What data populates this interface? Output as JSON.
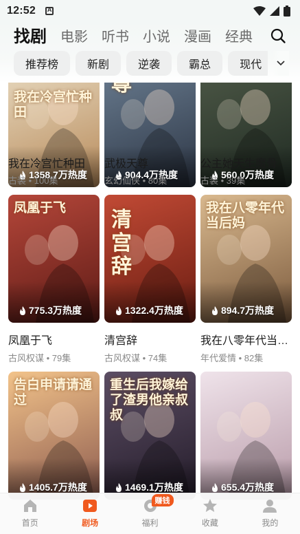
{
  "status_bar": {
    "time": "12:52"
  },
  "top_tabs": [
    {
      "label": "找剧",
      "active": true
    },
    {
      "label": "电影",
      "active": false
    },
    {
      "label": "听书",
      "active": false
    },
    {
      "label": "小说",
      "active": false
    },
    {
      "label": "漫画",
      "active": false
    },
    {
      "label": "经典",
      "active": false
    }
  ],
  "chips": [
    "推荐榜",
    "新剧",
    "逆袭",
    "霸总",
    "现代"
  ],
  "cards": [
    {
      "title": "我在冷宫忙种田",
      "sub": "古装 • 100集",
      "heat": "1358.7万热度",
      "poster_text": "我在冷宫忙种田",
      "colors": [
        "#e9dcc3",
        "#b78a5a"
      ]
    },
    {
      "title": "武极天尊",
      "sub": "玄幻仙侠 • 80集",
      "heat": "904.4万热度",
      "poster_text": "尊",
      "colors": [
        "#6c7f93",
        "#2c3544"
      ]
    },
    {
      "title": "公主她天生魔骨",
      "sub": "古装 • 39集",
      "heat": "560.0万热度",
      "poster_text": "",
      "colors": [
        "#4f5a48",
        "#1f2a22"
      ]
    },
    {
      "title": "凤凰于飞",
      "sub": "古风权谋 • 79集",
      "heat": "775.3万热度",
      "poster_text": "凤凰于飞",
      "colors": [
        "#b5473a",
        "#5e1b16"
      ]
    },
    {
      "title": "清宫辞",
      "sub": "古风权谋 • 74集",
      "heat": "1322.4万热度",
      "poster_text": "清宫辞",
      "colors": [
        "#c14a35",
        "#6b1d12"
      ]
    },
    {
      "title": "我在八零年代当…",
      "sub": "年代爱情 • 82集",
      "heat": "894.7万热度",
      "poster_text": "我在八零年代当后妈",
      "colors": [
        "#d9b98f",
        "#7b5a3d"
      ]
    },
    {
      "title": "",
      "sub": "",
      "heat": "1405.7万热度",
      "poster_text": "告白申请请通过",
      "colors": [
        "#f2c38a",
        "#8c5a4e"
      ]
    },
    {
      "title": "",
      "sub": "",
      "heat": "1469.1万热度",
      "poster_text": "重生后我嫁给了渣男他亲叔叔",
      "colors": [
        "#5c4e64",
        "#241c2a"
      ]
    },
    {
      "title": "",
      "sub": "",
      "heat": "655.4万热度",
      "poster_text": "",
      "colors": [
        "#efe3ea",
        "#b89aa8"
      ]
    }
  ],
  "bottom_nav": [
    {
      "label": "首页",
      "icon": "home-icon",
      "active": false
    },
    {
      "label": "剧场",
      "icon": "theater-icon",
      "active": true
    },
    {
      "label": "福利",
      "icon": "coin-icon",
      "active": false,
      "badge": "赚钱"
    },
    {
      "label": "收藏",
      "icon": "star-icon",
      "active": false
    },
    {
      "label": "我的",
      "icon": "profile-icon",
      "active": false
    }
  ],
  "accent_color": "#f0591e"
}
